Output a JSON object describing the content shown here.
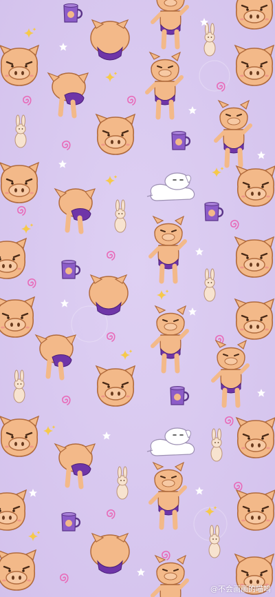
{
  "wallpaper": {
    "theme": "pig-character-pattern",
    "colors": {
      "background": "#d9c9f0",
      "pig_skin": "#f3b989",
      "pig_outline": "#b06a3c",
      "shorts": "#6f35a8",
      "swirl": "#e86ab8",
      "sparkle_gold": "#f6c94a",
      "star_white": "#ffffff",
      "bunny": "#f7e3cf",
      "dog": "#ffffff",
      "mug": "#8c5cc8"
    },
    "motifs": [
      "pig-face-icon",
      "pig-back-icon",
      "pig-standing-icon",
      "pig-bent-over-icon",
      "pig-kneeling-icon",
      "white-dog-icon",
      "bunny-icon",
      "mug-icon",
      "swirl-icon",
      "sparkle-icon",
      "star-icon"
    ]
  },
  "watermark": {
    "text": "@不会画画的喵呜"
  }
}
